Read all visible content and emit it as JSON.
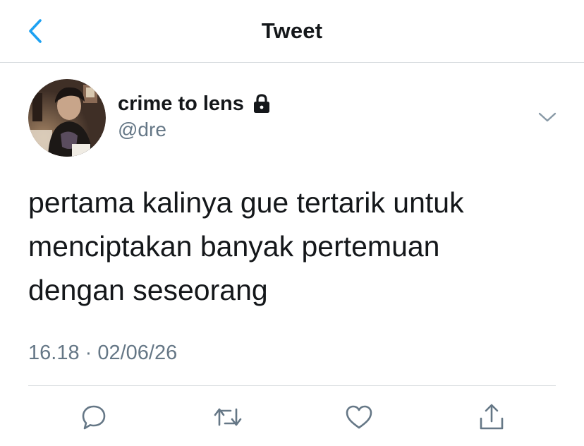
{
  "nav": {
    "title": "Tweet",
    "back_icon": "chevron-left-icon",
    "accent_color": "#1da1f2"
  },
  "tweet": {
    "display_name": "crime to lens",
    "protected_icon": "lock-icon",
    "handle": "@dre",
    "more_icon": "chevron-down-icon",
    "text_lines": [
      "pertama kalinya gue tertarik untuk",
      "menciptakan banyak pertemuan",
      "dengan seseorang"
    ],
    "timestamp": "16.18 · 02/06/26"
  },
  "actions": {
    "reply_icon": "reply-icon",
    "retweet_icon": "retweet-icon",
    "like_icon": "heart-icon",
    "share_icon": "share-icon"
  },
  "colors": {
    "text_primary": "#14171a",
    "text_secondary": "#657786",
    "divider": "#d9dde0",
    "icon_gray": "#657786"
  }
}
